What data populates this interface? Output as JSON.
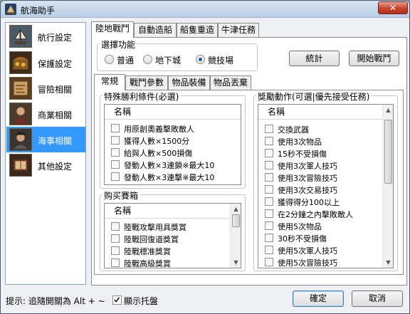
{
  "window": {
    "title": "航海助手",
    "close_glyph": "✕"
  },
  "sidebar": {
    "items": [
      {
        "label": "航行設定",
        "icon": "sailing-ship-icon",
        "selected": false
      },
      {
        "label": "保護設定",
        "icon": "treasure-chest-icon",
        "selected": false
      },
      {
        "label": "冒險相關",
        "icon": "map-scroll-icon",
        "selected": false
      },
      {
        "label": "商業相關",
        "icon": "merchant-icon",
        "selected": false
      },
      {
        "label": "海事相關",
        "icon": "pirate-icon",
        "selected": true
      },
      {
        "label": "其他設定",
        "icon": "book-icon",
        "selected": false
      }
    ]
  },
  "top_tabs": [
    "陸地戰鬥",
    "自動造船",
    "船隻重造",
    "牛津任務"
  ],
  "mode_group": {
    "legend": "選擇功能",
    "options": [
      "普通",
      "地下城",
      "競技場"
    ],
    "selected": "競技場"
  },
  "buttons": {
    "stats": "統計",
    "start_battle": "開始戰鬥",
    "ok": "確定",
    "cancel": "取消"
  },
  "sub_tabs": [
    "常規",
    "戰鬥參數",
    "物品裝備",
    "物品丟棄"
  ],
  "special_win": {
    "legend": "特殊勝利條件(必選)",
    "header": "名稱",
    "rows": [
      "用原創奧義擊敗敵人",
      "獲得人數×1500分",
      "給與人數×500損傷",
      "發動人數×3連鎖※最大10",
      "發動人數×3連擊※最大10"
    ]
  },
  "purchase": {
    "legend": "购买賽箱",
    "header": "名稱",
    "rows": [
      "陸戰攻擊用具獎賞",
      "陸戰回復道獎賞",
      "陸戰標准獎賞",
      "陸戰高級獎賞"
    ]
  },
  "reward_actions": {
    "legend": "獎勵動作(可選|優先接受任務)",
    "header": "名稱",
    "rows": [
      "交換武器",
      "使用3次物品",
      "15秒不受損傷",
      "使用3次軍人技巧",
      "使用3次冒險技巧",
      "使用3次交易技巧",
      "獲得得分100以上",
      "在2分鐘之內擊敗敵人",
      "使用5次物品",
      "30秒不受損傷",
      "使用5次軍人技巧",
      "使用5次冒險技巧"
    ]
  },
  "footer": {
    "hint": "提示: 追隨開關為 Alt + ~",
    "tray_label": "顯示托盤",
    "tray_checked": true
  }
}
